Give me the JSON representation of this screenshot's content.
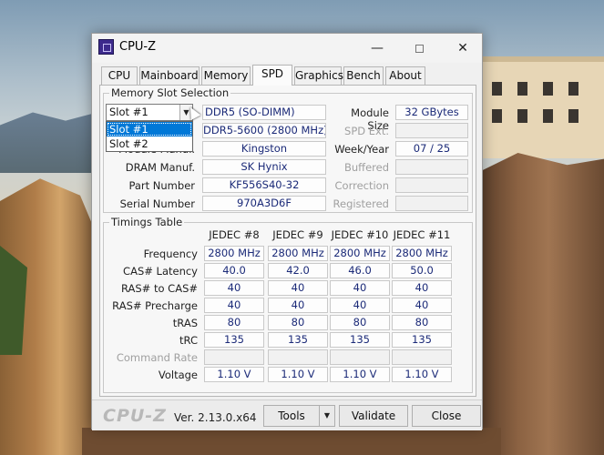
{
  "window": {
    "title": "CPU-Z",
    "min_glyph": "—",
    "close_glyph": "✕",
    "icon": "cpuz-app-icon"
  },
  "tabs": [
    "CPU",
    "Mainboard",
    "Memory",
    "SPD",
    "Graphics",
    "Bench",
    "About"
  ],
  "active_tab": "SPD",
  "slot_group": {
    "title": "Memory Slot Selection",
    "selected_slot": "Slot #1",
    "dropdown_options": [
      "Slot #1",
      "Slot #2"
    ],
    "module_type": "DDR5 (SO-DIMM)",
    "max_bandwidth": "DDR5-5600 (2800 MHz)",
    "module_manuf_label": "Module Manuf.",
    "module_manuf": "Kingston",
    "dram_manuf_label": "DRAM Manuf.",
    "dram_manuf": "SK Hynix",
    "part_number_label": "Part Number",
    "part_number": "KF556S40-32",
    "serial_number_label": "Serial Number",
    "serial_number": "970A3D6F",
    "module_size_label": "Module Size",
    "module_size": "32 GBytes",
    "spd_ext_label": "SPD Ext.",
    "spd_ext": "",
    "week_year_label": "Week/Year",
    "week_year": "07 / 25",
    "buffered_label": "Buffered",
    "correction_label": "Correction",
    "registered_label": "Registered"
  },
  "timings": {
    "title": "Timings Table",
    "columns": [
      "JEDEC #8",
      "JEDEC #9",
      "JEDEC #10",
      "JEDEC #11"
    ],
    "rows": [
      {
        "label": "Frequency",
        "dim": false,
        "values": [
          "2800 MHz",
          "2800 MHz",
          "2800 MHz",
          "2800 MHz"
        ]
      },
      {
        "label": "CAS# Latency",
        "dim": false,
        "values": [
          "40.0",
          "42.0",
          "46.0",
          "50.0"
        ]
      },
      {
        "label": "RAS# to CAS#",
        "dim": false,
        "values": [
          "40",
          "40",
          "40",
          "40"
        ]
      },
      {
        "label": "RAS# Precharge",
        "dim": false,
        "values": [
          "40",
          "40",
          "40",
          "40"
        ]
      },
      {
        "label": "tRAS",
        "dim": false,
        "values": [
          "80",
          "80",
          "80",
          "80"
        ]
      },
      {
        "label": "tRC",
        "dim": false,
        "values": [
          "135",
          "135",
          "135",
          "135"
        ]
      },
      {
        "label": "Command Rate",
        "dim": true,
        "values": [
          "",
          "",
          "",
          ""
        ]
      },
      {
        "label": "Voltage",
        "dim": false,
        "values": [
          "1.10 V",
          "1.10 V",
          "1.10 V",
          "1.10 V"
        ]
      }
    ]
  },
  "bottom": {
    "logo": "CPU-Z",
    "version": "Ver. 2.13.0.x64",
    "tools_label": "Tools",
    "validate_label": "Validate",
    "close_label": "Close"
  },
  "colors": {
    "value_text": "#1b2a78",
    "selection": "#0078d7"
  }
}
